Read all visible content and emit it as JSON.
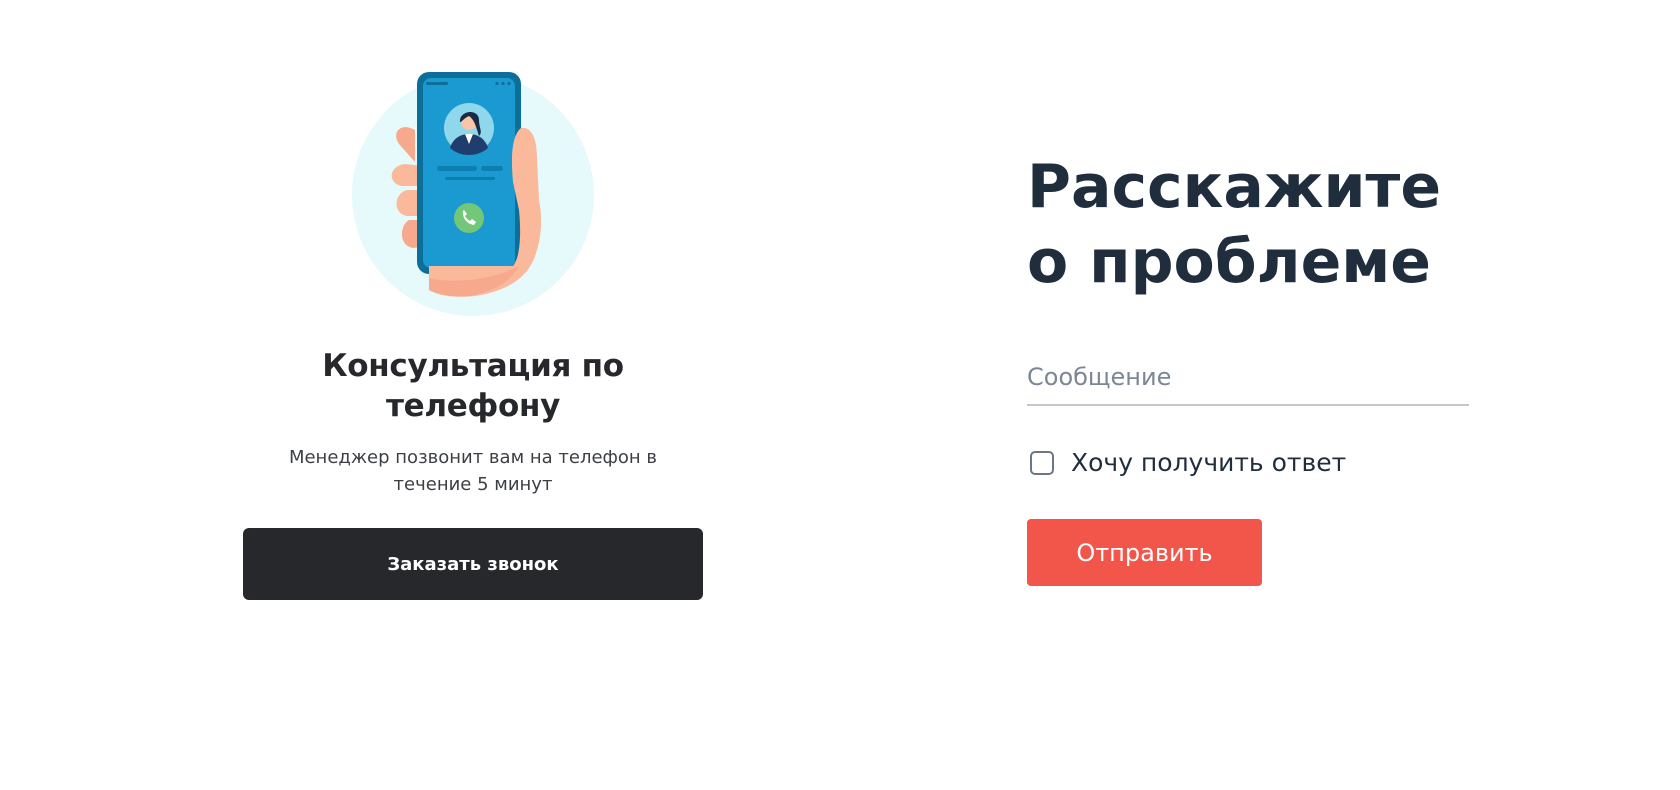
{
  "consultation": {
    "illustration": "phone-call-illustration",
    "title": "Консультация по телефону",
    "description": "Менеджер позвонит вам на телефон в течение 5 минут",
    "button_label": "Заказать звонок"
  },
  "form": {
    "title_line1": "Расскажите",
    "title_line2": "о проблеме",
    "message_placeholder": "Сообщение",
    "message_value": "",
    "checkbox_label": "Хочу получить ответ",
    "checkbox_checked": false,
    "submit_label": "Отправить"
  },
  "colors": {
    "dark_button": "#26282c",
    "accent": "#f2554a",
    "title": "#1f2d3d",
    "circle_bg": "#e6f9fb",
    "phone_blue": "#1a9ad0",
    "call_green": "#72c778"
  }
}
